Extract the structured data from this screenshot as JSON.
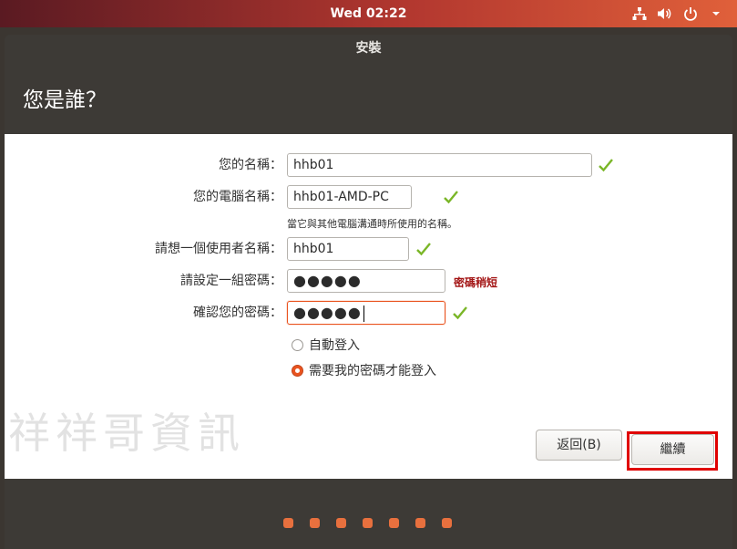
{
  "topbar": {
    "clock": "Wed 02:22",
    "icons": [
      "network-icon",
      "volume-icon",
      "power-icon"
    ]
  },
  "window": {
    "title": "安裝",
    "page_title": "您是誰？"
  },
  "form": {
    "name_label": "您的名稱：",
    "name_value": "hhb01",
    "computer_label": "您的電腦名稱：",
    "computer_value": "hhb01-AMD-PC",
    "computer_hint": "當它與其他電腦溝通時所使用的名稱。",
    "username_label": "請想一個使用者名稱：",
    "username_value": "hhb01",
    "password_label": "請設定一組密碼：",
    "password_value": "●●●●●",
    "password_strength": "密碼稍短",
    "confirm_label": "確認您的密碼：",
    "confirm_value": "●●●●●"
  },
  "login_options": {
    "auto_login": "自動登入",
    "require_password": "需要我的密碼才能登入",
    "selected": "require_password"
  },
  "watermark": "祥祥哥資訊",
  "buttons": {
    "back": "返回(B)",
    "continue": "繼續"
  },
  "progress": {
    "total_steps": 7
  },
  "colors": {
    "accent": "#e95420",
    "check": "#7ab627",
    "warning": "#a31515",
    "highlight": "#e00000"
  }
}
